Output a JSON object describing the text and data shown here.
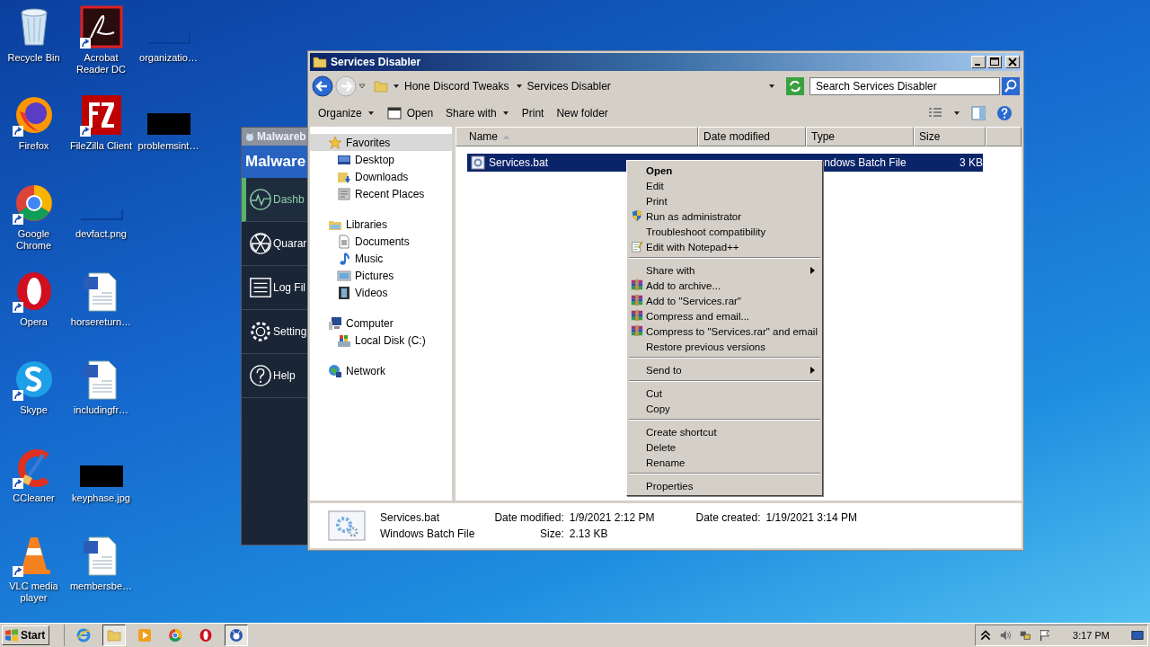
{
  "desktop": {
    "icon_columns": [
      [
        {
          "label": "Recycle Bin",
          "kind": "recycle-bin",
          "shortcut": false
        },
        {
          "label": "Firefox",
          "kind": "firefox",
          "shortcut": true
        },
        {
          "label": "Google Chrome",
          "kind": "chrome",
          "shortcut": true
        },
        {
          "label": "Opera",
          "kind": "opera",
          "shortcut": true
        },
        {
          "label": "Skype",
          "kind": "skype",
          "shortcut": true
        },
        {
          "label": "CCleaner",
          "kind": "ccleaner",
          "shortcut": true
        },
        {
          "label": "VLC media player",
          "kind": "vlc",
          "shortcut": true
        }
      ],
      [
        {
          "label": "Acrobat Reader DC",
          "kind": "pdf",
          "shortcut": true
        },
        {
          "label": "FileZilla Client",
          "kind": "filezilla",
          "shortcut": true
        },
        {
          "label": "devfact.png",
          "kind": "blank-image",
          "shortcut": false
        },
        {
          "label": "horsereturn…",
          "kind": "document",
          "shortcut": false
        },
        {
          "label": "includingfr…",
          "kind": "document",
          "shortcut": false
        },
        {
          "label": "keyphase.jpg",
          "kind": "black-image",
          "shortcut": false
        },
        {
          "label": "membersbe…",
          "kind": "document",
          "shortcut": false
        }
      ],
      [
        {
          "label": "organizatio…",
          "kind": "blank-image",
          "shortcut": false
        },
        {
          "label": "problemsint…",
          "kind": "black-image",
          "shortcut": false
        }
      ]
    ]
  },
  "background_window": {
    "title": "Malwareb",
    "logo": "Malware",
    "nav": [
      {
        "label": "Dashb",
        "kind": "dashboard",
        "selected": true
      },
      {
        "label": "Quarar",
        "kind": "quarantine",
        "selected": false
      },
      {
        "label": "Log Fil",
        "kind": "log",
        "selected": false
      },
      {
        "label": "Setting",
        "kind": "settings",
        "selected": false
      },
      {
        "label": "Help",
        "kind": "help",
        "selected": false
      }
    ]
  },
  "explorer": {
    "title": "Services Disabler",
    "breadcrumb": [
      "Hone Discord Tweaks",
      "Services Disabler"
    ],
    "search": {
      "placeholder": "Search Services Disabler"
    },
    "toolbar": [
      {
        "label": "Organize",
        "kind": "dropdown"
      },
      {
        "label": "Open",
        "kind": "open"
      },
      {
        "label": "Share with",
        "kind": "dropdown"
      },
      {
        "label": "Print",
        "kind": "plain"
      },
      {
        "label": "New folder",
        "kind": "plain"
      }
    ],
    "nav_pane": [
      {
        "label": "Favorites",
        "kind": "star",
        "selected": true,
        "children": [
          {
            "label": "Desktop",
            "kind": "desktop"
          },
          {
            "label": "Downloads",
            "kind": "downloads"
          },
          {
            "label": "Recent Places",
            "kind": "recent"
          }
        ]
      },
      {
        "label": "Libraries",
        "kind": "libraries",
        "selected": false,
        "children": [
          {
            "label": "Documents",
            "kind": "documents"
          },
          {
            "label": "Music",
            "kind": "music"
          },
          {
            "label": "Pictures",
            "kind": "pictures"
          },
          {
            "label": "Videos",
            "kind": "videos"
          }
        ]
      },
      {
        "label": "Computer",
        "kind": "computer",
        "selected": false,
        "children": [
          {
            "label": "Local Disk (C:)",
            "kind": "disk"
          }
        ]
      },
      {
        "label": "Network",
        "kind": "network",
        "selected": false
      }
    ],
    "columns": [
      "Name",
      "Date modified",
      "Type",
      "Size"
    ],
    "files": [
      {
        "name": "Services.bat",
        "type": "ndows Batch File",
        "size": "3 KB",
        "selected": true
      }
    ],
    "details": {
      "name": "Services.bat",
      "type": "Windows Batch File",
      "modified_label": "Date modified:",
      "modified": "1/9/2021 2:12 PM",
      "size_label": "Size:",
      "size": "2.13 KB",
      "created_label": "Date created:",
      "created": "1/19/2021 3:14 PM"
    }
  },
  "context_menu": {
    "groups": [
      [
        {
          "label": "Open",
          "kind": "plain",
          "default": true,
          "submenu": false
        },
        {
          "label": "Edit",
          "kind": "plain",
          "default": false,
          "submenu": false
        },
        {
          "label": "Print",
          "kind": "plain",
          "default": false,
          "submenu": false
        },
        {
          "label": "Run as administrator",
          "kind": "admin",
          "default": false,
          "submenu": false
        },
        {
          "label": "Troubleshoot compatibility",
          "kind": "plain",
          "default": false,
          "submenu": false
        },
        {
          "label": "Edit with Notepad++",
          "kind": "editor",
          "default": false,
          "submenu": false
        }
      ],
      [
        {
          "label": "Share with",
          "kind": "plain",
          "default": false,
          "submenu": true
        },
        {
          "label": "Add to archive...",
          "kind": "archive",
          "default": false,
          "submenu": false
        },
        {
          "label": "Add to \"Services.rar\"",
          "kind": "archive",
          "default": false,
          "submenu": false
        },
        {
          "label": "Compress and email...",
          "kind": "archive",
          "default": false,
          "submenu": false
        },
        {
          "label": "Compress to \"Services.rar\" and email",
          "kind": "archive",
          "default": false,
          "submenu": false
        },
        {
          "label": "Restore previous versions",
          "kind": "plain",
          "default": false,
          "submenu": false
        }
      ],
      [
        {
          "label": "Send to",
          "kind": "plain",
          "default": false,
          "submenu": true
        }
      ],
      [
        {
          "label": "Cut",
          "kind": "plain",
          "default": false,
          "submenu": false
        },
        {
          "label": "Copy",
          "kind": "plain",
          "default": false,
          "submenu": false
        }
      ],
      [
        {
          "label": "Create shortcut",
          "kind": "plain",
          "default": false,
          "submenu": false
        },
        {
          "label": "Delete",
          "kind": "plain",
          "default": false,
          "submenu": false
        },
        {
          "label": "Rename",
          "kind": "plain",
          "default": false,
          "submenu": false
        }
      ],
      [
        {
          "label": "Properties",
          "kind": "plain",
          "default": false,
          "submenu": false
        }
      ]
    ]
  },
  "taskbar": {
    "start": "Start",
    "apps": [
      {
        "kind": "ie",
        "active": false
      },
      {
        "kind": "explorer",
        "active": true
      },
      {
        "kind": "media",
        "active": false
      },
      {
        "kind": "chrome",
        "active": false
      },
      {
        "kind": "opera",
        "active": false
      },
      {
        "kind": "malware",
        "active": true
      }
    ],
    "clock": "3:17 PM"
  }
}
